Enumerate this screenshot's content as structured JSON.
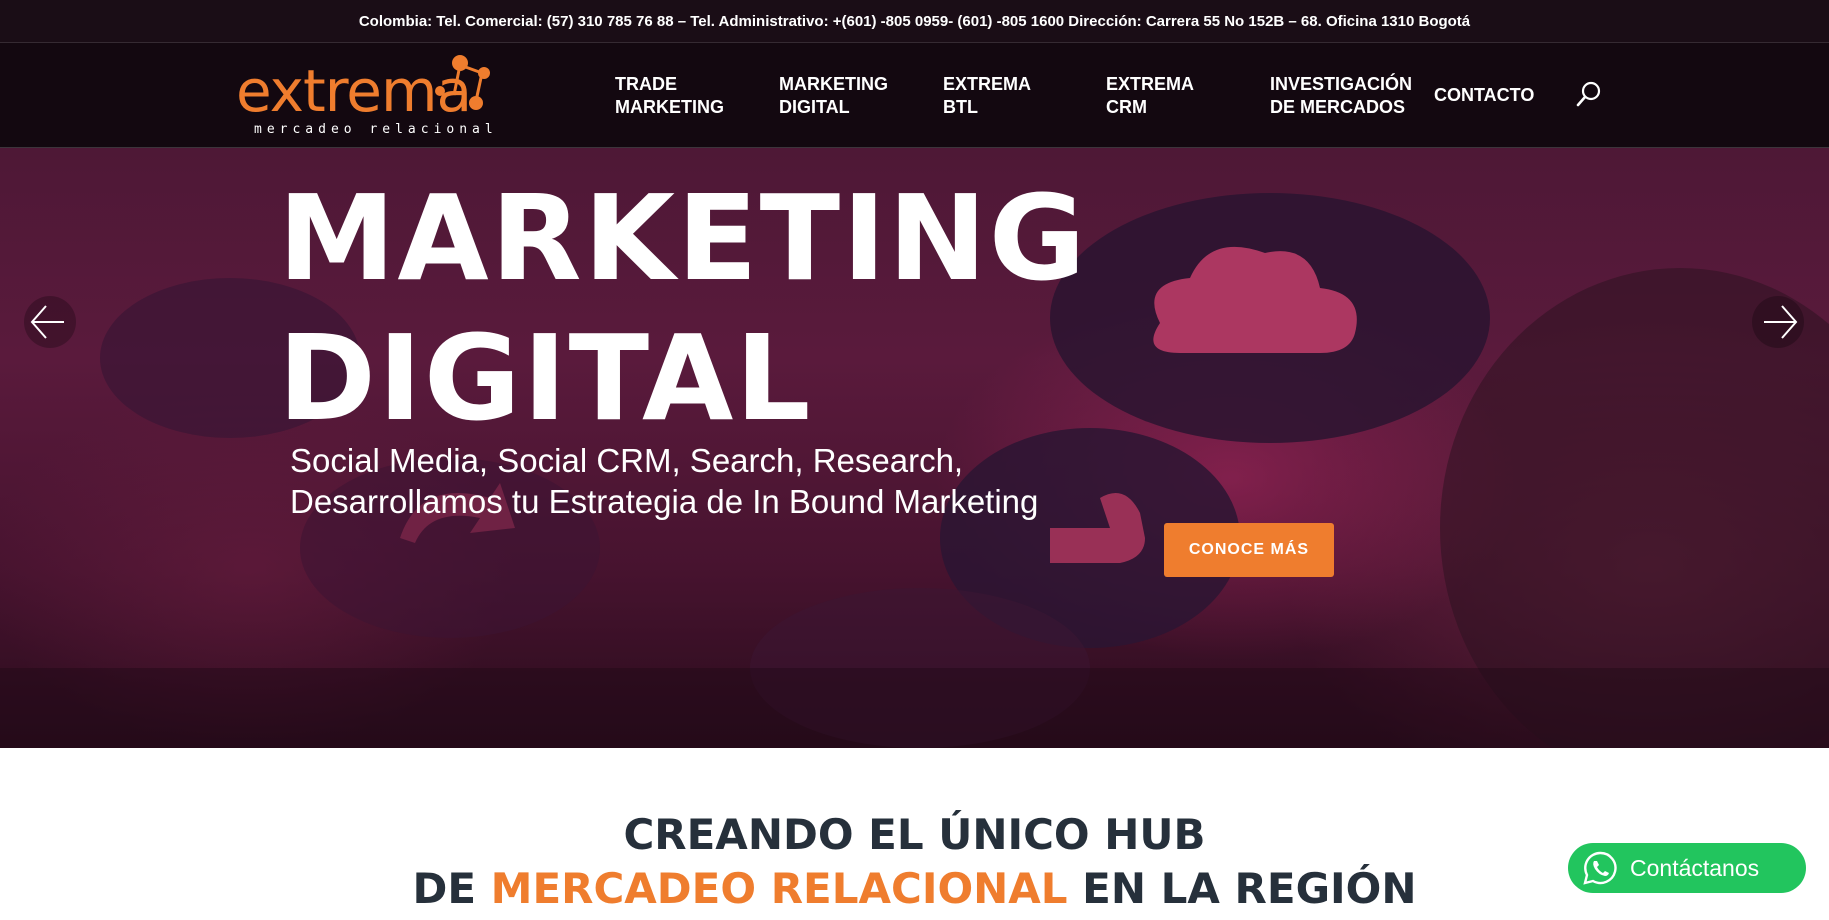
{
  "topbar": {
    "country": "Colombia:",
    "info": "Tel. Comercial: (57) 310 785 76 88 – Tel. Administrativo:  +(601) -805 0959- (601) -805 1600  Dirección: Carrera 55 No 152B – 68. Oficina 1310 Bogotá"
  },
  "logo": {
    "word": "extrema",
    "tagline": "mercadeo relacional"
  },
  "nav": {
    "items": [
      {
        "line1": "TRADE",
        "line2": "MARKETING"
      },
      {
        "line1": "MARKETING",
        "line2": "DIGITAL"
      },
      {
        "line1": "EXTREMA",
        "line2": "BTL"
      },
      {
        "line1": "EXTREMA",
        "line2": "CRM"
      },
      {
        "line1": "INVESTIGACIÓN",
        "line2": "DE MERCADOS"
      },
      {
        "line1": "CONTACTO",
        "line2": ""
      }
    ],
    "search_icon": "search-icon"
  },
  "hero": {
    "title_line1": "MARKETING",
    "title_line2": "DIGITAL",
    "subtitle_line1": "Social Media, Social CRM, Search, Research,",
    "subtitle_line2": "Desarrollamos tu Estrategia de In Bound Marketing",
    "cta_label": "CONOCE MÁS",
    "prev_icon": "arrow-left-icon",
    "next_icon": "arrow-right-icon"
  },
  "content": {
    "heading_line1": "CREANDO EL ÚNICO HUB",
    "heading_line2_pre": "DE ",
    "heading_line2_accent": "MERCADEO RELACIONAL",
    "heading_line2_post": " EN LA REGIÓN"
  },
  "whatsapp": {
    "label": "Contáctanos",
    "icon": "whatsapp-icon"
  },
  "colors": {
    "accent": "#ef7d2e",
    "header_bg": "#130810",
    "hero_overlay": "#5a1a3c",
    "heading_text": "#26303b",
    "whatsapp_green": "#22c55e"
  }
}
